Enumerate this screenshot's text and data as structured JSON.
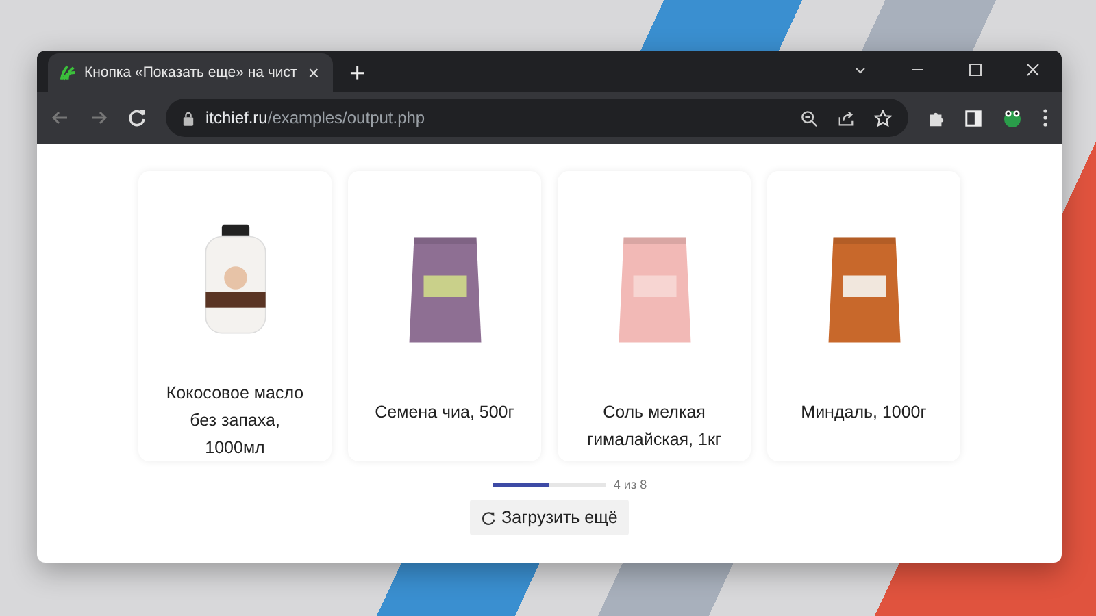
{
  "tab": {
    "title": "Кнопка «Показать еще» на чист",
    "close": "×"
  },
  "new_tab": "+",
  "address_bar": {
    "host": "itchief.ru",
    "path": "/examples/output.php"
  },
  "products": [
    {
      "name": "Кокосовое масло без запаха, 1000мл"
    },
    {
      "name": "Семена чиа, 500г"
    },
    {
      "name": "Соль мелкая гималайская, 1кг"
    },
    {
      "name": "Миндаль, 1000г"
    }
  ],
  "progress": {
    "level": 0.5,
    "reading": "4 из 8"
  },
  "load_more_button": {
    "label": "Загрузить ещё"
  }
}
